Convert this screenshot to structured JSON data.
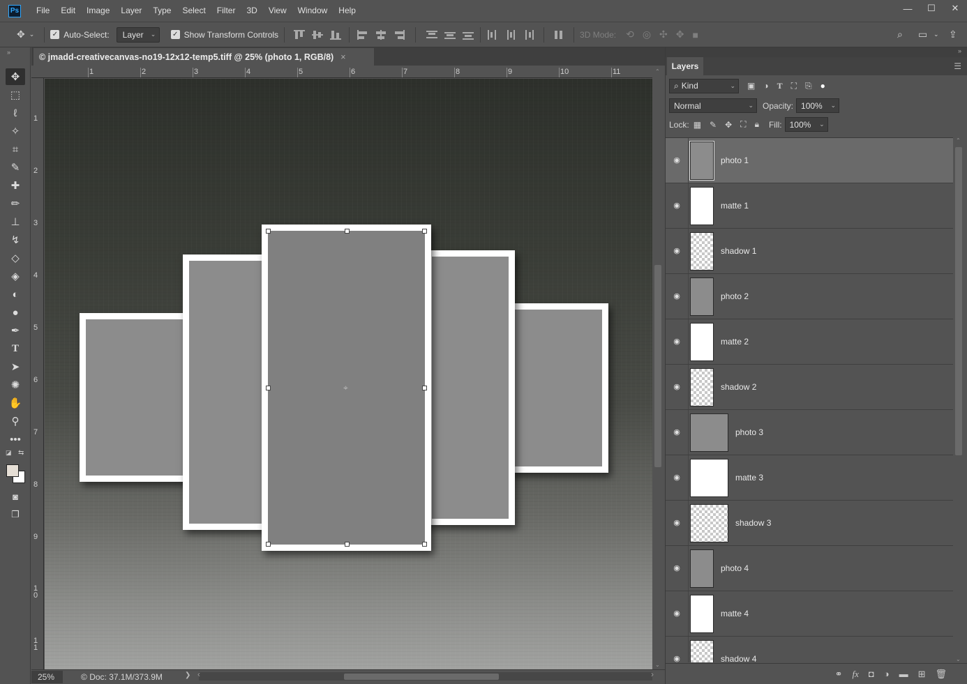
{
  "app": {
    "logo": "Ps"
  },
  "menu": [
    "File",
    "Edit",
    "Image",
    "Layer",
    "Type",
    "Select",
    "Filter",
    "3D",
    "View",
    "Window",
    "Help"
  ],
  "window_controls": {
    "minimize": "—",
    "maximize": "☐",
    "close": "✕"
  },
  "options": {
    "auto_select_label": "Auto-Select:",
    "auto_select_value": "Layer",
    "show_transform_label": "Show Transform Controls",
    "three_d_mode_label": "3D Mode:"
  },
  "document": {
    "tab_title": "© jmadd-creativecanvas-no19-12x12-temp5.tiff @ 25% (photo 1, RGB/8)",
    "close_glyph": "×"
  },
  "ruler_top": [
    "1",
    "2",
    "3",
    "4",
    "5",
    "6",
    "7",
    "8",
    "9",
    "10",
    "11"
  ],
  "ruler_left": [
    "1",
    "2",
    "3",
    "4",
    "5",
    "6",
    "7",
    "8",
    "9",
    "1\n0",
    "1\n1"
  ],
  "status": {
    "zoom": "25%",
    "doc_info": "Doc: 37.1M/373.9M",
    "doc_icon": "©",
    "arrow": "❯",
    "scroll_left": "‹",
    "scroll_right": "›"
  },
  "layers_panel": {
    "tab_label": "Layers",
    "filter_kind": "Kind",
    "blend_mode": "Normal",
    "opacity_label": "Opacity:",
    "opacity_value": "100%",
    "lock_label": "Lock:",
    "fill_label": "Fill:",
    "fill_value": "100%",
    "layers": [
      {
        "name": "photo 1",
        "thumb": "gray",
        "selected": true
      },
      {
        "name": "matte 1",
        "thumb": "white",
        "selected": false
      },
      {
        "name": "shadow 1",
        "thumb": "checker",
        "selected": false
      },
      {
        "name": "photo 2",
        "thumb": "gray",
        "selected": false
      },
      {
        "name": "matte 2",
        "thumb": "white",
        "selected": false
      },
      {
        "name": "shadow 2",
        "thumb": "checker",
        "selected": false
      },
      {
        "name": "photo 3",
        "thumb": "gray",
        "selected": false
      },
      {
        "name": "matte 3",
        "thumb": "white",
        "selected": false
      },
      {
        "name": "shadow 3",
        "thumb": "checker",
        "selected": false
      },
      {
        "name": "photo 4",
        "thumb": "gray",
        "selected": false
      },
      {
        "name": "matte 4",
        "thumb": "white",
        "selected": false
      },
      {
        "name": "shadow 4",
        "thumb": "checker",
        "selected": false
      }
    ],
    "footer_icons": [
      "link-icon",
      "fx-icon",
      "mask-icon",
      "adjustment-icon",
      "folder-icon",
      "new-layer-icon",
      "trash-icon"
    ]
  },
  "colors": {
    "foreground": "#e6dfd6",
    "background": "#ffffff",
    "accent": "#31a8ff"
  }
}
